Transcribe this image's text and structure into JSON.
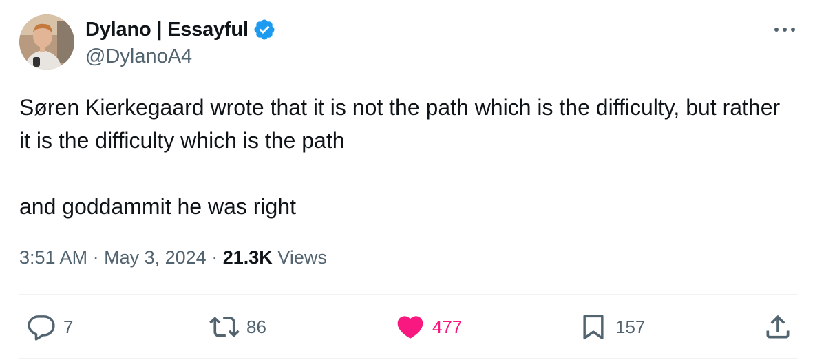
{
  "author": {
    "display_name": "Dylano | Essayful",
    "handle": "@DylanoA4",
    "verified": true,
    "avatar": "profile-photo"
  },
  "tweet": {
    "paragraphs": [
      "Søren Kierkegaard wrote that it is not the path which is the difficulty, but rather it is the difficulty which is the path",
      "and goddammit he was right"
    ],
    "time": "3:51 AM",
    "date": "May 3, 2024",
    "separator": "·",
    "views_count": "21.3K",
    "views_label": "Views"
  },
  "actions": {
    "replies": "7",
    "reposts": "86",
    "likes": "477",
    "bookmarks": "157"
  },
  "icons": {
    "more": "more-horizontal-icon",
    "verified": "verified-badge-icon",
    "reply": "reply-icon",
    "repost": "repost-icon",
    "like": "heart-icon",
    "bookmark": "bookmark-icon",
    "share": "share-icon"
  },
  "colors": {
    "text_primary": "#0f1419",
    "text_secondary": "#536471",
    "verified_blue": "#1d9bf0",
    "like_pink": "#f91880",
    "divider": "#eff3f4"
  }
}
